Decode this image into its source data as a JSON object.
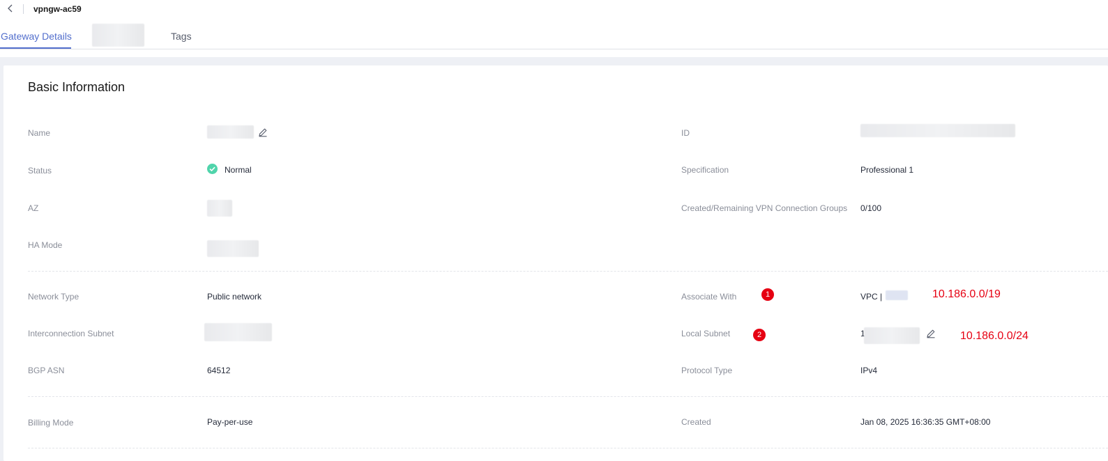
{
  "header": {
    "title": "vpngw-ac59"
  },
  "tabs": [
    {
      "label": "Gateway Details",
      "active": true
    },
    {
      "label": "Tags",
      "active": false
    }
  ],
  "section": {
    "title": "Basic Information"
  },
  "fields": {
    "name": {
      "label": "Name"
    },
    "id": {
      "label": "ID"
    },
    "status": {
      "label": "Status",
      "value": "Normal"
    },
    "specification": {
      "label": "Specification",
      "value": "Professional 1"
    },
    "az": {
      "label": "AZ"
    },
    "connection_groups": {
      "label": "Created/Remaining VPN Connection Groups",
      "value": "0/100"
    },
    "ha_mode": {
      "label": "HA Mode"
    },
    "network_type": {
      "label": "Network Type",
      "value": "Public network"
    },
    "associate_with": {
      "label": "Associate With",
      "value_prefix": "VPC |"
    },
    "interconnection_subnet": {
      "label": "Interconnection Subnet"
    },
    "local_subnet": {
      "label": "Local Subnet",
      "value_prefix": "1"
    },
    "bgp_asn": {
      "label": "BGP ASN",
      "value": "64512"
    },
    "protocol_type": {
      "label": "Protocol Type",
      "value": "IPv4"
    },
    "billing_mode": {
      "label": "Billing Mode",
      "value": "Pay-per-use"
    },
    "created": {
      "label": "Created",
      "value": "Jan 08, 2025 16:36:35 GMT+08:00"
    }
  },
  "annotations": [
    {
      "badge": "1",
      "text": "10.186.0.0/19"
    },
    {
      "badge": "2",
      "text": "10.186.0.0/24"
    }
  ],
  "colors": {
    "accent": "#526ecc",
    "success": "#50d4ab",
    "annotation": "#e60012"
  }
}
